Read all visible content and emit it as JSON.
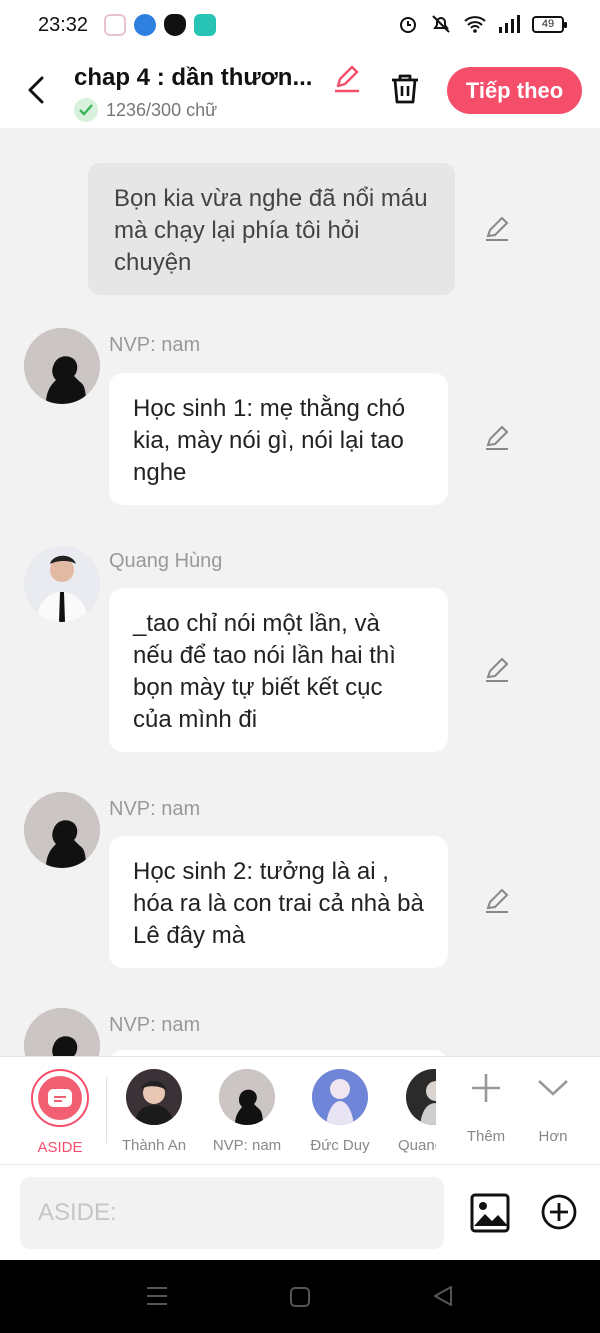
{
  "status": {
    "time": "23:32",
    "battery": "49"
  },
  "header": {
    "title": "chap 4 : dần thươn...",
    "word_count": "1236/300 chữ",
    "next_label": "Tiếp theo"
  },
  "chat": {
    "aside_text": "Bọn kia vừa nghe đã nổi máu mà chạy lại phía tôi hỏi chuyện",
    "messages": [
      {
        "name": "NVP: nam",
        "text": "Học sinh 1: mẹ thằng chó kia, mày nói gì, nói lại tao nghe"
      },
      {
        "name": "Quang Hùng",
        "text": "_tao chỉ nói một lần, và nếu để tao nói lần hai thì bọn mày tự biết kết cục của mình đi"
      },
      {
        "name": "NVP: nam",
        "text": "Học sinh 2: tưởng là ai , hóa ra là con trai cả nhà bà Lê đây mà"
      },
      {
        "name": "NVP: nam",
        "text": ""
      }
    ]
  },
  "characters": {
    "aside_label": "ASIDE",
    "items": [
      "Thành An",
      "NVP: nam",
      "Đức Duy",
      "Quang"
    ],
    "add_label": "Thêm",
    "more_label": "Hơn"
  },
  "input": {
    "placeholder": "ASIDE:"
  },
  "colors": {
    "accent": "#f54e6b",
    "background": "#f2f2f2",
    "bubble": "#ffffff",
    "aside_bubble": "#e6e6e6"
  }
}
